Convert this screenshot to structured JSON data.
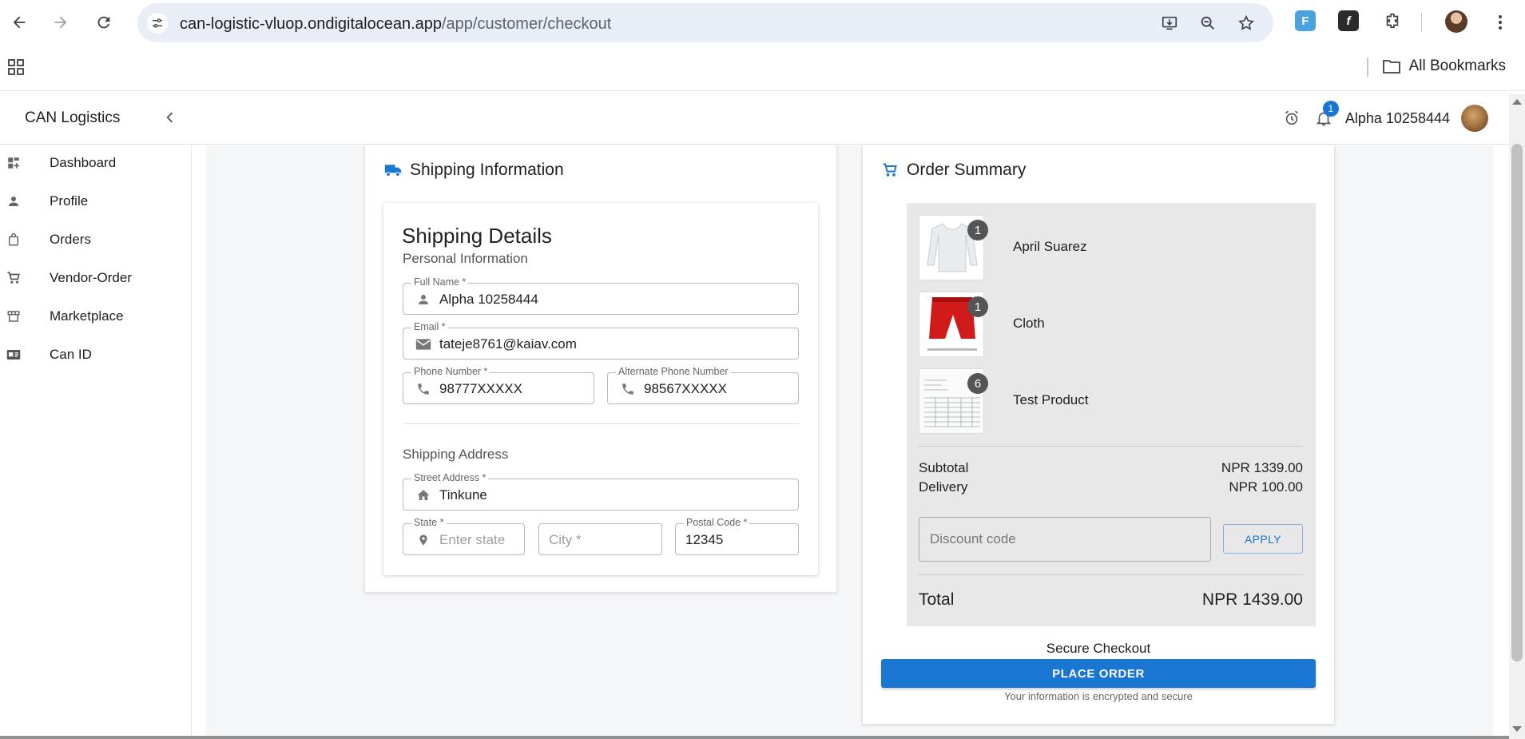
{
  "browser": {
    "url_host": "can-logistic-vluop.ondigitalocean.app",
    "url_path": "/app/customer/checkout",
    "bookmarks_label": "All Bookmarks",
    "extensions": [
      "F",
      "f",
      ""
    ]
  },
  "header": {
    "brand": "CAN Logistics",
    "notifications_count": "1",
    "user_name": "Alpha 10258444"
  },
  "sidebar": {
    "items": [
      {
        "label": "Dashboard",
        "icon": "dashboard-icon"
      },
      {
        "label": "Profile",
        "icon": "person-icon"
      },
      {
        "label": "Orders",
        "icon": "shopping-bag-icon"
      },
      {
        "label": "Vendor-Order",
        "icon": "cart-icon"
      },
      {
        "label": "Marketplace",
        "icon": "store-icon"
      },
      {
        "label": "Can ID",
        "icon": "id-card-icon"
      }
    ]
  },
  "shipping": {
    "title": "Shipping Information",
    "details_title": "Shipping Details",
    "personal_info": "Personal Information",
    "full_name": {
      "label": "Full Name *",
      "value": "Alpha 10258444"
    },
    "email": {
      "label": "Email *",
      "value": "tateje8761@kaiav.com"
    },
    "phone": {
      "label": "Phone Number *",
      "value": "98777XXXXX"
    },
    "alt_phone": {
      "label": "Alternate Phone Number",
      "value": "98567XXXXX"
    },
    "address_title": "Shipping Address",
    "street": {
      "label": "Street Address *",
      "value": "Tinkune"
    },
    "state": {
      "label": "State *",
      "placeholder": "Enter state"
    },
    "city": {
      "placeholder": "City *"
    },
    "postal": {
      "label": "Postal Code *",
      "value": "12345"
    }
  },
  "order": {
    "title": "Order Summary",
    "items": [
      {
        "name": "April Suarez",
        "qty": "1"
      },
      {
        "name": "Cloth",
        "qty": "1"
      },
      {
        "name": "Test Product",
        "qty": "6"
      }
    ],
    "subtotal_label": "Subtotal",
    "subtotal_value": "NPR 1339.00",
    "delivery_label": "Delivery",
    "delivery_value": "NPR 100.00",
    "discount_placeholder": "Discount code",
    "apply_label": "APPLY",
    "total_label": "Total",
    "total_value": "NPR 1439.00",
    "secure_label": "Secure Checkout",
    "place_order_label": "PLACE ORDER",
    "encrypted_note": "Your information is encrypted and secure"
  },
  "colors": {
    "accent": "#1976d2",
    "summary_bg": "#e8e8e8",
    "main_bg": "#f5f6f8"
  }
}
